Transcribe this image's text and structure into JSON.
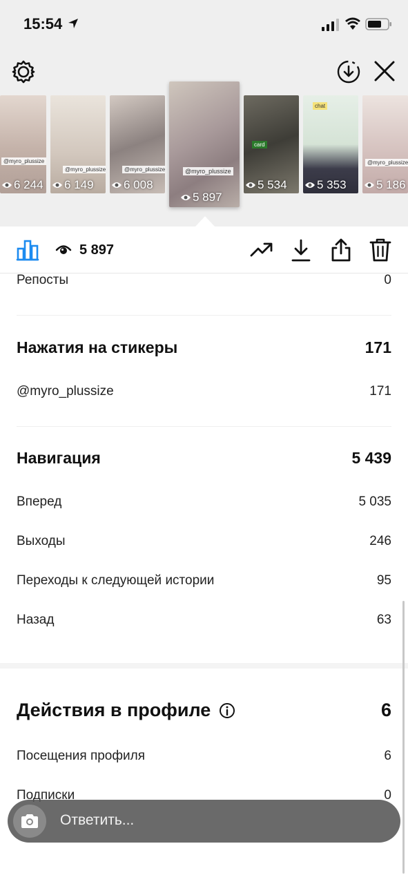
{
  "status_bar": {
    "time": "15:54"
  },
  "icons": {
    "settings": "gear-icon",
    "download_circle": "download-circle-icon",
    "close": "close-icon",
    "insights": "bar-chart-icon",
    "views": "eye-icon",
    "trend": "trending-up-icon",
    "download": "download-icon",
    "share": "share-icon",
    "delete": "trash-icon",
    "camera": "camera-icon",
    "info": "info-icon"
  },
  "stories": [
    {
      "views": "6 244",
      "color": "#c9b8b0"
    },
    {
      "views": "6 149",
      "color": "#d6cfc6"
    },
    {
      "views": "6 008",
      "color": "#b7aaa3"
    },
    {
      "views": "5 897",
      "color": "#a89b98",
      "selected": true,
      "label": "@myro_plussize"
    },
    {
      "views": "5 534",
      "color": "#5b5a52"
    },
    {
      "views": "5 353",
      "color": "#9fb0a3"
    },
    {
      "views": "5 186",
      "color": "#d9c7c3"
    }
  ],
  "toolbar": {
    "views_count": "5 897"
  },
  "stats": {
    "reposts": {
      "label": "Репосты",
      "value": "0"
    },
    "sticker_taps": {
      "label": "Нажатия на стикеры",
      "value": "171"
    },
    "sticker_mention": {
      "label": "@myro_plussize",
      "value": "171"
    },
    "navigation": {
      "label": "Навигация",
      "value": "5 439"
    },
    "forward": {
      "label": "Вперед",
      "value": "5 035"
    },
    "exits": {
      "label": "Выходы",
      "value": "246"
    },
    "next_story": {
      "label": "Переходы к следующей истории",
      "value": "95"
    },
    "back": {
      "label": "Назад",
      "value": "63"
    },
    "profile_actions": {
      "label": "Действия в профиле",
      "value": "6"
    },
    "profile_visits": {
      "label": "Посещения профиля",
      "value": "6"
    },
    "follows": {
      "label": "Подписки",
      "value": "0"
    }
  },
  "reply": {
    "placeholder": "Ответить..."
  }
}
